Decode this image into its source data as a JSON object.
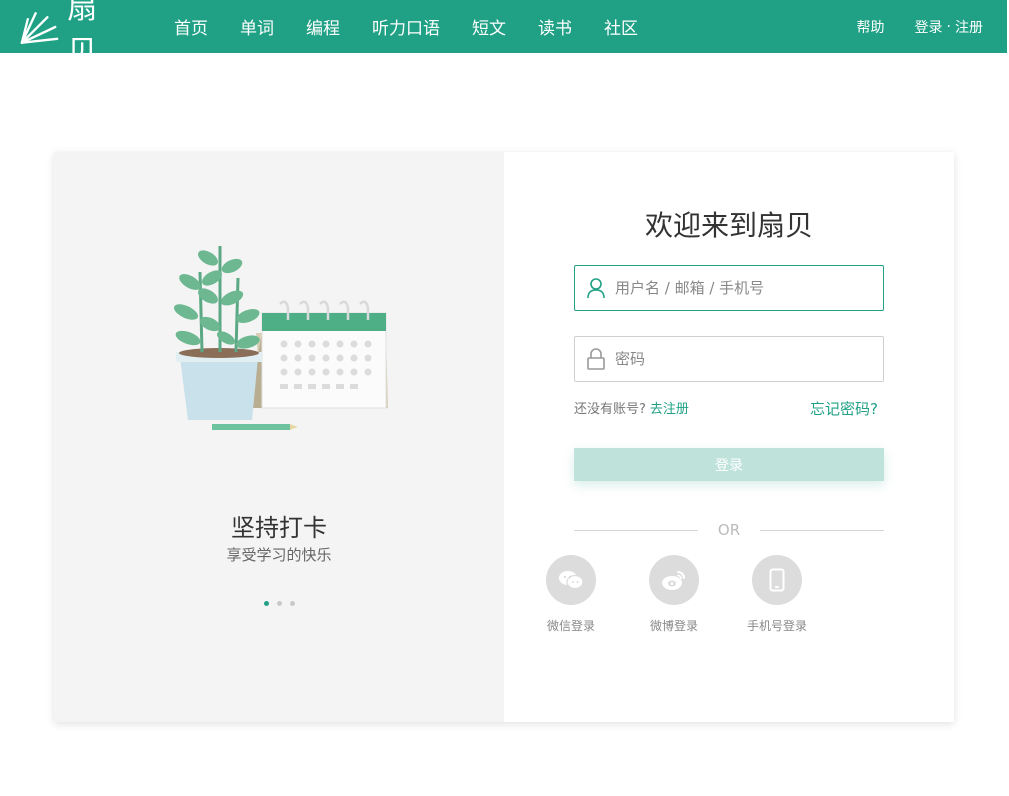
{
  "header": {
    "logo_text": "扇贝",
    "nav": [
      "首页",
      "单词",
      "编程",
      "听力口语",
      "短文",
      "读书",
      "社区"
    ],
    "help": "帮助",
    "login": "登录",
    "separator": "·",
    "register": "注册"
  },
  "slide": {
    "title": "坚持打卡",
    "subtitle": "享受学习的快乐",
    "dots": 3,
    "active_dot": 0
  },
  "login": {
    "welcome": "欢迎来到扇贝",
    "username_placeholder": "用户名 / 邮箱 / 手机号",
    "password_placeholder": "密码",
    "no_account": "还没有账号?",
    "go_register": "去注册",
    "forgot": "忘记密码?",
    "submit": "登录",
    "or": "OR",
    "social": {
      "wechat": "微信登录",
      "weibo": "微博登录",
      "phone": "手机号登录"
    }
  },
  "colors": {
    "brand": "#20a185",
    "button_disabled": "#bfe3da",
    "social_bg": "#dcdcdc"
  },
  "icons": [
    "shell-logo-icon",
    "user-icon",
    "lock-icon",
    "wechat-icon",
    "weibo-icon",
    "phone-icon"
  ]
}
